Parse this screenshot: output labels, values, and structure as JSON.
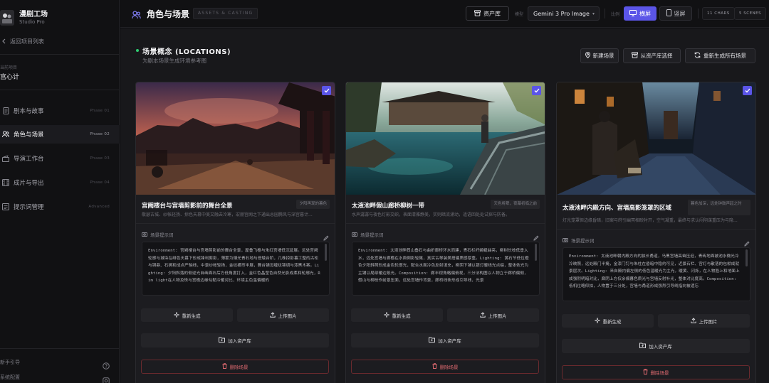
{
  "brand": {
    "name": "漫剧工场",
    "subtitle": "Studio Pro"
  },
  "sidebar": {
    "back_label": "返回项目列表",
    "project_label": "当前项目",
    "project_name": "宫心计",
    "items": [
      {
        "label": "剧本与故事",
        "phase": "Phase 01",
        "icon": "script-icon"
      },
      {
        "label": "角色与场景",
        "phase": "Phase 02",
        "icon": "users-icon",
        "active": true
      },
      {
        "label": "导演工作台",
        "phase": "Phase 03",
        "icon": "clapper-icon"
      },
      {
        "label": "成片与导出",
        "phase": "Phase 04",
        "icon": "film-icon"
      },
      {
        "label": "提示词管理",
        "phase": "Advanced",
        "icon": "prompt-icon"
      }
    ],
    "footer": [
      {
        "label": "新手引导",
        "icon": "help-icon"
      },
      {
        "label": "系统配置",
        "icon": "settings-icon"
      }
    ]
  },
  "header": {
    "title": "角色与场景",
    "tag": "ASSETS & CASTING",
    "assets_button": "资产库",
    "model_label": "模型",
    "model_value": "Gemini 3 Pro Image",
    "ratio_label": "比例",
    "landscape_label": "横屏",
    "portrait_label": "竖屏",
    "chars_stat": "11 CHARS",
    "scenes_stat": "5 SCENES"
  },
  "section": {
    "title": "场景概念 (LOCATIONS)",
    "subtitle": "为剧本场景生成环境参考图",
    "new_scene": "新建场景",
    "from_library": "从资产库选择",
    "regen_all": "重新生成所有场景"
  },
  "cards": [
    {
      "title": "宫阙楼台与宫墙剪影前的舞台全景",
      "badge": "夕阳再现的暮色",
      "desc": "敬瑟古城、纱帐轻扬、掠色天幕中美又融去冷寒，宏丽宫阙之下通出总园腾风与深宫暮计...",
      "prompt_label": "场景提示词",
      "prompt": "Environment: 宫阙楼台与宫墙剪影前的舞台全景，屋叠飞檐与朱红宫墙低沉延展。远处宫阙轮廓与城垛在绯色天幕下形成锋利剪影，薄雾为烟光青石地与低矮台阶，几株掠影暮工整的古松与铜鼎、石狮和成点严轴线，中景纱帐轻扬，金纹横帘半展，舞台铺设缠纹锦绸与漆黑木案。Lighting: 夕阳斜落的侧逆光自画面右后方低角度打入，金红色晶莹色自然光影成柔和轮廓光，Rim light在人物及珠与宫檐边缘勾勒冷暖对比，环境主色温偏暖的",
      "regen": "重新生成",
      "upload": "上传图片",
      "add_asset": "加入资产库",
      "delete": "删除场景"
    },
    {
      "title": "太液池畔假山廊桥柳树一带",
      "badge": "天色将晕，夜幕初临之前",
      "desc": "水声潺潺与夜色灯影交织，表面清雅静美，实则暗流涌动，适语回处处试探与防备。",
      "prompt_label": "场景提示词",
      "prompt": "Environment: 太液池畔假山叠石与曲折廊桥环水而建，青石栏杆蜿蜒曲亮，柳树长枝低垂入水，远处宫墙与廊檐在水面倒影轻晃，真实古琴装美搭建质感厚重。Lighting: 黄石节低位橙色夕阳斜照形成金色轮廓光，配合水面冷色反射填充，柳阴下铺以银灯暖线光点缀，整体依光为主铺以局部暖边氛光。Composition: 廊半视角略偏俯视，三分法构图以人物立于廊桥偏侧，假山与柳枝作前景压面，远处宫墙作背景，廊桥线条形成引导线，光景",
      "regen": "重新生成",
      "upload": "上传图片",
      "add_asset": "加入资产库",
      "delete": "删除场景"
    },
    {
      "title": "太液池畔内殿方向、宫墙高影笼罩的区域",
      "badge": "暮色加深，远处钟鼓声起之时",
      "desc": "灯光笼罩但边缘昏暗，旧案与莳引幽冥相映衬开，空气凝重，最终与求认闷阴谋重压为与隐...",
      "prompt_label": "场景提示词",
      "prompt": "Environment: 太液池畔朝内殿方向的狭长甬道，乌黑宫墙高耸压迫，青砖地面被池水微光冷冷映照，远处殿门半掩，金漆门钉与朱柱在昏暗中隐约可见，近景石栏、宫灯与散落的包袱成就景层次。Lighting: 来自殿内偏左侧的低色温暖光为主光，暖黄、闪烁，在人物脸上和地面上成强烈明暗对比，廊阴上方仅余偏暮色质光与宫墙反射补光，整体对比度高。Composition: 低机位略仰拍，人物置于三分处，宫墙与甬道形成强烈引导线指向被遗忘",
      "regen": "重新生成",
      "upload": "上传图片",
      "add_asset": "加入资产库",
      "delete": "删除场景"
    }
  ],
  "colors": {
    "accent": "#5b55e8",
    "danger": "#e06a70",
    "success": "#2ecc71"
  }
}
